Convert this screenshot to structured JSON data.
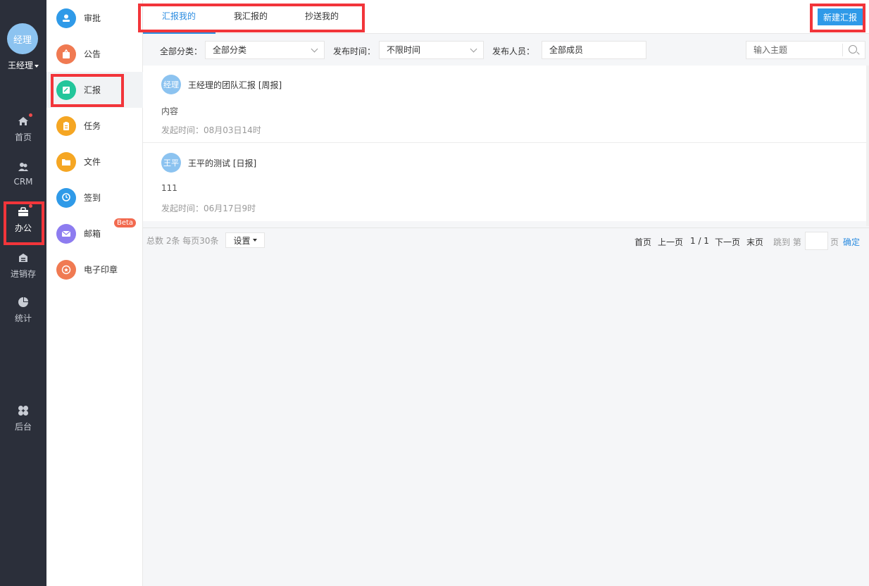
{
  "user": {
    "avatar_text": "经理",
    "name": "王经理"
  },
  "rail": {
    "items": [
      {
        "label": "首页",
        "icon": "home-icon",
        "badge": true
      },
      {
        "label": "CRM",
        "icon": "users-icon",
        "badge": false
      },
      {
        "label": "办公",
        "icon": "briefcase-icon",
        "badge": true,
        "active": true
      },
      {
        "label": "进销存",
        "icon": "store-icon",
        "badge": false
      },
      {
        "label": "统计",
        "icon": "pie-chart-icon",
        "badge": false
      },
      {
        "label": "后台",
        "icon": "grid-icon",
        "badge": false
      }
    ]
  },
  "submenu": {
    "items": [
      {
        "label": "审批",
        "icon": "approval-icon",
        "color": "#2f9ae8"
      },
      {
        "label": "公告",
        "icon": "announcement-icon",
        "color": "#f07a52"
      },
      {
        "label": "汇报",
        "icon": "report-icon",
        "color": "#23c69b",
        "active": true
      },
      {
        "label": "任务",
        "icon": "task-icon",
        "color": "#f5a623"
      },
      {
        "label": "文件",
        "icon": "folder-icon",
        "color": "#f5a623"
      },
      {
        "label": "签到",
        "icon": "location-icon",
        "color": "#2f9ae8"
      },
      {
        "label": "邮箱",
        "icon": "mail-icon",
        "color": "#8d7cf0",
        "badge": "Beta"
      },
      {
        "label": "电子印章",
        "icon": "seal-icon",
        "color": "#f07a52"
      }
    ]
  },
  "tabs": [
    "汇报我的",
    "我汇报的",
    "抄送我的"
  ],
  "new_button": "新建汇报",
  "filters": {
    "category_label": "全部分类：",
    "category_value": "全部分类",
    "time_label": "发布时间：",
    "time_value": "不限时间",
    "person_label": "发布人员：",
    "person_value": "全部成员",
    "search_placeholder": "输入主题"
  },
  "reports": [
    {
      "avatar": "经理",
      "title": "王经理的团队汇报 [周报]",
      "content": "内容",
      "time": "发起时间：08月03日14时"
    },
    {
      "avatar": "王平",
      "title": "王平的测试 [日报]",
      "content": "111",
      "time": "发起时间：06月17日9时"
    }
  ],
  "pager": {
    "total": "总数 2条 每页30条",
    "settings": "设置",
    "first": "首页",
    "prev": "上一页",
    "page": "1 / 1",
    "next": "下一页",
    "last": "末页",
    "jump_prefix": "跳到 第",
    "jump_suffix": "页",
    "confirm": "确定"
  },
  "colors": {
    "accent": "#2b8ce0",
    "rail": "#2b2f3a",
    "highlight": "#f2353a"
  }
}
